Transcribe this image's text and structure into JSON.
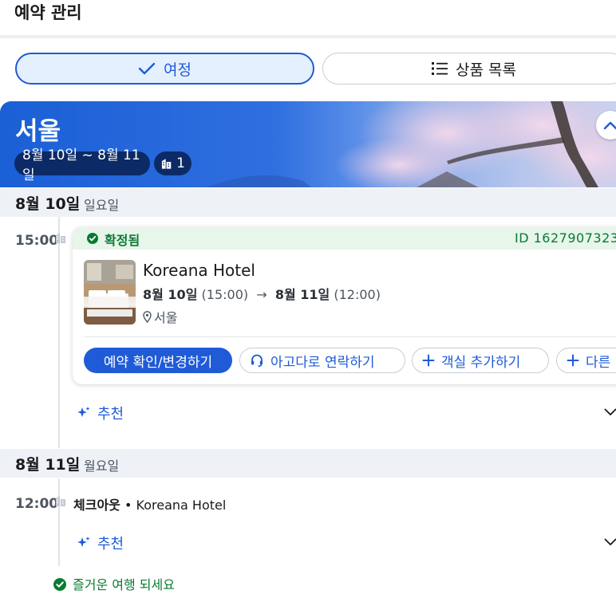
{
  "header": {
    "title": "예약 관리"
  },
  "tabs": [
    {
      "label": "여정",
      "icon": "check-icon",
      "selected": true
    },
    {
      "label": "상품 목록",
      "icon": "list-icon",
      "selected": false
    }
  ],
  "banner": {
    "city": "서울",
    "date_range": "8월 10일 ~ 8월 11일",
    "hotel_count": "1",
    "collapse_icon": "chevron-up-icon"
  },
  "days": [
    {
      "date": "8월 10일",
      "weekday": "일요일",
      "event": {
        "time": "15:00",
        "status": "확정됨",
        "booking_id": "ID 1627907323",
        "hotel_name": "Koreana Hotel",
        "checkin_date": "8월 10일",
        "checkin_time": "(15:00)",
        "arrow": "→",
        "checkout_date": "8월 11일",
        "checkout_time": "(12:00)",
        "location": "서울",
        "actions": [
          {
            "label": "예약 확인/변경하기",
            "icon": ""
          },
          {
            "label": "아고다로 연락하기",
            "icon": "headset-icon"
          },
          {
            "label": "객실 추가하기",
            "icon": "plus-icon"
          },
          {
            "label": "다른",
            "icon": "plus-icon"
          }
        ]
      },
      "recommend": "추천"
    },
    {
      "date": "8월 11일",
      "weekday": "월요일",
      "event": {
        "time": "12:00",
        "label": "체크아웃",
        "separator": "•",
        "hotel": "Koreana Hotel"
      },
      "recommend": "추천"
    }
  ],
  "footer": {
    "message": "즐거운 여행 되세요"
  },
  "colors": {
    "accent": "#1f5bd7",
    "confirmed": "#0a7a32",
    "banner_dark": "#0c2a66"
  }
}
